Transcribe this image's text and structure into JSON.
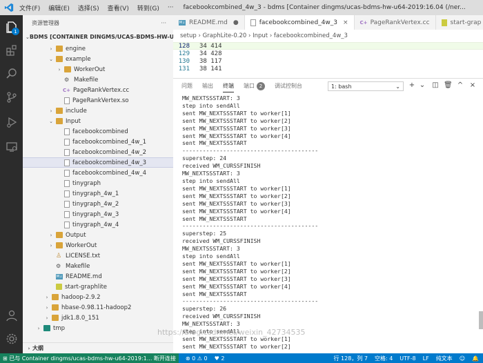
{
  "titlebar": {
    "menus": [
      "文件(F)",
      "编辑(E)",
      "选择(S)",
      "查看(V)",
      "转到(G)"
    ],
    "title": "facebookcombined_4w_3 - bdms [Container dingms/ucas-bdms-hw-u64-2019:16.04 (/ner..."
  },
  "sidebar": {
    "header": "资源管理器",
    "more": "···",
    "root": "BDMS [CONTAINER DINGMS/UCAS-BDMS-HW-U64-20...",
    "items": [
      {
        "label": "engine",
        "type": "folder",
        "indent": 2,
        "tw": "›"
      },
      {
        "label": "example",
        "type": "folder",
        "indent": 2,
        "tw": "⌄"
      },
      {
        "label": "WorkerOut",
        "type": "folder",
        "indent": 3,
        "tw": "›"
      },
      {
        "label": "Makefile",
        "type": "makefile",
        "indent": 3,
        "tw": ""
      },
      {
        "label": "PageRankVertex.cc",
        "type": "cc",
        "indent": 3,
        "tw": ""
      },
      {
        "label": "PageRankVertex.so",
        "type": "file",
        "indent": 3,
        "tw": ""
      },
      {
        "label": "include",
        "type": "folder",
        "indent": 2,
        "tw": "›"
      },
      {
        "label": "Input",
        "type": "folder",
        "indent": 2,
        "tw": "⌄"
      },
      {
        "label": "facebookcombined",
        "type": "file",
        "indent": 3,
        "tw": ""
      },
      {
        "label": "facebookcombined_4w_1",
        "type": "file",
        "indent": 3,
        "tw": ""
      },
      {
        "label": "facebookcombined_4w_2",
        "type": "file",
        "indent": 3,
        "tw": ""
      },
      {
        "label": "facebookcombined_4w_3",
        "type": "file",
        "indent": 3,
        "tw": "",
        "selected": true
      },
      {
        "label": "facebookcombined_4w_4",
        "type": "file",
        "indent": 3,
        "tw": ""
      },
      {
        "label": "tinygraph",
        "type": "file",
        "indent": 3,
        "tw": ""
      },
      {
        "label": "tinygraph_4w_1",
        "type": "file",
        "indent": 3,
        "tw": ""
      },
      {
        "label": "tinygraph_4w_2",
        "type": "file",
        "indent": 3,
        "tw": ""
      },
      {
        "label": "tinygraph_4w_3",
        "type": "file",
        "indent": 3,
        "tw": ""
      },
      {
        "label": "tinygraph_4w_4",
        "type": "file",
        "indent": 3,
        "tw": ""
      },
      {
        "label": "Output",
        "type": "folder",
        "indent": 2,
        "tw": "›"
      },
      {
        "label": "WorkerOut",
        "type": "folder",
        "indent": 2,
        "tw": "›"
      },
      {
        "label": "LICENSE.txt",
        "type": "license",
        "indent": 2,
        "tw": ""
      },
      {
        "label": "Makefile",
        "type": "makefile",
        "indent": 2,
        "tw": ""
      },
      {
        "label": "README.md",
        "type": "md",
        "indent": 2,
        "tw": ""
      },
      {
        "label": "start-graphlite",
        "type": "json",
        "indent": 2,
        "tw": ""
      },
      {
        "label": "hadoop-2.9.2",
        "type": "folder",
        "indent": 1,
        "tw": "›"
      },
      {
        "label": "hbase-0.98.11-hadoop2",
        "type": "folder",
        "indent": 1,
        "tw": "›"
      },
      {
        "label": "jdk1.8.0_151",
        "type": "folder",
        "indent": 1,
        "tw": "›"
      },
      {
        "label": "tmp",
        "type": "tmp",
        "indent": 0,
        "tw": "›"
      }
    ],
    "outline": "大纲"
  },
  "tabs": [
    {
      "label": "README.md",
      "icon": "md",
      "close": "●"
    },
    {
      "label": "facebookcombined_4w_3",
      "icon": "file",
      "close": "×",
      "active": true
    },
    {
      "label": "PageRankVertex.cc",
      "icon": "cc",
      "close": ""
    },
    {
      "label": "start-grap",
      "icon": "json",
      "close": ""
    }
  ],
  "breadcrumb": "setup › GraphLite-0.20 › Input › facebookcombined_4w_3",
  "code": [
    {
      "ln": "128",
      "text": "34 414",
      "current": true
    },
    {
      "ln": "129",
      "text": "34 428"
    },
    {
      "ln": "130",
      "text": "38 117"
    },
    {
      "ln": "131",
      "text": "38 141"
    }
  ],
  "panel": {
    "tabs": [
      "问题",
      "输出",
      "终端",
      "端口",
      "调试控制台"
    ],
    "active_tab": "终端",
    "ports_badge": "2",
    "terminal_select": "1: bash",
    "terminal_lines": [
      "MW_NEXTSSSTART: 3",
      "step into sendAll",
      "sent MW_NEXTSSSTART to worker[1]",
      "sent MW_NEXTSSSTART to worker[2]",
      "sent MW_NEXTSSSTART to worker[3]",
      "sent MW_NEXTSSSTART to worker[4]",
      "sent MW_NEXTSSSTART",
      "----------------------------------------",
      "superstep: 24",
      "received WM_CURSSFINISH",
      "MW_NEXTSSSTART: 3",
      "step into sendAll",
      "sent MW_NEXTSSSTART to worker[1]",
      "sent MW_NEXTSSSTART to worker[2]",
      "sent MW_NEXTSSSTART to worker[3]",
      "sent MW_NEXTSSSTART to worker[4]",
      "sent MW_NEXTSSSTART",
      "----------------------------------------",
      "superstep: 25",
      "received WM_CURSSFINISH",
      "MW_NEXTSSSTART: 3",
      "step into sendAll",
      "sent MW_NEXTSSSTART to worker[1]",
      "sent MW_NEXTSSSTART to worker[2]",
      "sent MW_NEXTSSSTART to worker[3]",
      "sent MW_NEXTSSSTART to worker[4]",
      "sent MW_NEXTSSSTART",
      "----------------------------------------",
      "superstep: 26",
      "received WM_CURSSFINISH",
      "MW_NEXTSSSTART: 3",
      "step into sendAll",
      "sent MW_NEXTSSSTART to worker[1]",
      "sent MW_NEXTSSSTART to worker[2]"
    ],
    "watermark": "https://blog.csdn.net/weixin_42734535"
  },
  "statusbar": {
    "remote": "⊞ 已与 Container dingms/ucas-bdms-hw-u64-2019:1...  断开连接",
    "problems": "⊗ 0 ⚠ 0",
    "branch": "♥ 2",
    "position": "行 128，列 7",
    "spaces": "空格: 4",
    "encoding": "UTF-8",
    "eol": "LF",
    "language": "纯文本"
  },
  "colors": {
    "activity_bar": "#2c2c2c",
    "status_bar": "#007acc",
    "remote": "#16825d",
    "folder": "#d9a43a"
  }
}
